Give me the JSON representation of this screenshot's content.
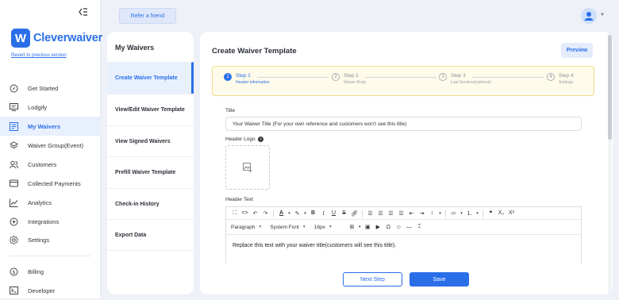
{
  "sidebar": {
    "brand": "Cleverwaiver",
    "logo_letter": "W",
    "revert_link": "Revert to previous version",
    "items": [
      {
        "label": "Get Started",
        "icon": "compass-icon"
      },
      {
        "label": "Lodgify",
        "icon": "monitor-icon"
      },
      {
        "label": "My Waivers",
        "icon": "document-icon"
      },
      {
        "label": "Waiver Group(Event)",
        "icon": "layers-icon"
      },
      {
        "label": "Customers",
        "icon": "users-icon"
      },
      {
        "label": "Collected Payments",
        "icon": "credit-card-icon"
      },
      {
        "label": "Analytics",
        "icon": "chart-line-icon"
      },
      {
        "label": "Integrations",
        "icon": "link-icon"
      },
      {
        "label": "Settings",
        "icon": "gear-icon"
      }
    ],
    "bottom_items": [
      {
        "label": "Billing",
        "icon": "dollar-icon"
      },
      {
        "label": "Developer",
        "icon": "terminal-icon"
      }
    ],
    "active": "My Waivers"
  },
  "topbar": {
    "refer_label": "Refer a friend"
  },
  "panel": {
    "title": "My Waivers",
    "items": [
      "Create Waiver Template",
      "View/Edit Waiver Template",
      "View Signed Waivers",
      "Prefill Waiver Template",
      "Check-in History",
      "Export Data"
    ],
    "active": "Create Waiver Template"
  },
  "main": {
    "title": "Create Waiver Template",
    "preview_label": "Preview",
    "steps": [
      {
        "num": "1",
        "title": "Step 1",
        "sub": "Header information",
        "active": true
      },
      {
        "num": "2",
        "title": "Step 2",
        "sub": "Waiver Body",
        "active": false
      },
      {
        "num": "3",
        "title": "Step 3",
        "sub": "Last Sections(optional)",
        "active": false
      },
      {
        "num": "4",
        "title": "Step 4",
        "sub": "Settings",
        "active": false
      }
    ],
    "title_label": "Title",
    "title_value": "Your Waiver Title (For your own reference and customers won't see this title)",
    "header_logo_label": "Header Logo",
    "header_text_label": "Header Text",
    "editor": {
      "block_format": "Paragraph",
      "font_family": "System Font",
      "font_size": "16px",
      "content": "Replace this text with your waiver title(customers will see this title)."
    },
    "next_label": "Next Step",
    "save_label": "Save"
  },
  "colors": {
    "accent": "#2a6fe8",
    "active_bg": "#e8f0fe",
    "stepper_bg": "#fffbea",
    "stepper_border": "#f3d98b"
  }
}
